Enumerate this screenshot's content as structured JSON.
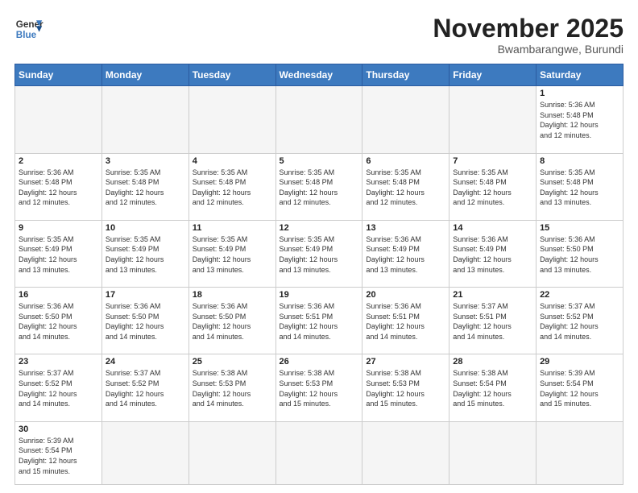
{
  "header": {
    "logo_general": "General",
    "logo_blue": "Blue",
    "month_title": "November 2025",
    "subtitle": "Bwambarangwe, Burundi"
  },
  "days_of_week": [
    "Sunday",
    "Monday",
    "Tuesday",
    "Wednesday",
    "Thursday",
    "Friday",
    "Saturday"
  ],
  "weeks": [
    [
      {
        "day": "",
        "info": ""
      },
      {
        "day": "",
        "info": ""
      },
      {
        "day": "",
        "info": ""
      },
      {
        "day": "",
        "info": ""
      },
      {
        "day": "",
        "info": ""
      },
      {
        "day": "",
        "info": ""
      },
      {
        "day": "1",
        "info": "Sunrise: 5:36 AM\nSunset: 5:48 PM\nDaylight: 12 hours\nand 12 minutes."
      }
    ],
    [
      {
        "day": "2",
        "info": "Sunrise: 5:36 AM\nSunset: 5:48 PM\nDaylight: 12 hours\nand 12 minutes."
      },
      {
        "day": "3",
        "info": "Sunrise: 5:35 AM\nSunset: 5:48 PM\nDaylight: 12 hours\nand 12 minutes."
      },
      {
        "day": "4",
        "info": "Sunrise: 5:35 AM\nSunset: 5:48 PM\nDaylight: 12 hours\nand 12 minutes."
      },
      {
        "day": "5",
        "info": "Sunrise: 5:35 AM\nSunset: 5:48 PM\nDaylight: 12 hours\nand 12 minutes."
      },
      {
        "day": "6",
        "info": "Sunrise: 5:35 AM\nSunset: 5:48 PM\nDaylight: 12 hours\nand 12 minutes."
      },
      {
        "day": "7",
        "info": "Sunrise: 5:35 AM\nSunset: 5:48 PM\nDaylight: 12 hours\nand 12 minutes."
      },
      {
        "day": "8",
        "info": "Sunrise: 5:35 AM\nSunset: 5:48 PM\nDaylight: 12 hours\nand 13 minutes."
      }
    ],
    [
      {
        "day": "9",
        "info": "Sunrise: 5:35 AM\nSunset: 5:49 PM\nDaylight: 12 hours\nand 13 minutes."
      },
      {
        "day": "10",
        "info": "Sunrise: 5:35 AM\nSunset: 5:49 PM\nDaylight: 12 hours\nand 13 minutes."
      },
      {
        "day": "11",
        "info": "Sunrise: 5:35 AM\nSunset: 5:49 PM\nDaylight: 12 hours\nand 13 minutes."
      },
      {
        "day": "12",
        "info": "Sunrise: 5:35 AM\nSunset: 5:49 PM\nDaylight: 12 hours\nand 13 minutes."
      },
      {
        "day": "13",
        "info": "Sunrise: 5:36 AM\nSunset: 5:49 PM\nDaylight: 12 hours\nand 13 minutes."
      },
      {
        "day": "14",
        "info": "Sunrise: 5:36 AM\nSunset: 5:49 PM\nDaylight: 12 hours\nand 13 minutes."
      },
      {
        "day": "15",
        "info": "Sunrise: 5:36 AM\nSunset: 5:50 PM\nDaylight: 12 hours\nand 13 minutes."
      }
    ],
    [
      {
        "day": "16",
        "info": "Sunrise: 5:36 AM\nSunset: 5:50 PM\nDaylight: 12 hours\nand 14 minutes."
      },
      {
        "day": "17",
        "info": "Sunrise: 5:36 AM\nSunset: 5:50 PM\nDaylight: 12 hours\nand 14 minutes."
      },
      {
        "day": "18",
        "info": "Sunrise: 5:36 AM\nSunset: 5:50 PM\nDaylight: 12 hours\nand 14 minutes."
      },
      {
        "day": "19",
        "info": "Sunrise: 5:36 AM\nSunset: 5:51 PM\nDaylight: 12 hours\nand 14 minutes."
      },
      {
        "day": "20",
        "info": "Sunrise: 5:36 AM\nSunset: 5:51 PM\nDaylight: 12 hours\nand 14 minutes."
      },
      {
        "day": "21",
        "info": "Sunrise: 5:37 AM\nSunset: 5:51 PM\nDaylight: 12 hours\nand 14 minutes."
      },
      {
        "day": "22",
        "info": "Sunrise: 5:37 AM\nSunset: 5:52 PM\nDaylight: 12 hours\nand 14 minutes."
      }
    ],
    [
      {
        "day": "23",
        "info": "Sunrise: 5:37 AM\nSunset: 5:52 PM\nDaylight: 12 hours\nand 14 minutes."
      },
      {
        "day": "24",
        "info": "Sunrise: 5:37 AM\nSunset: 5:52 PM\nDaylight: 12 hours\nand 14 minutes."
      },
      {
        "day": "25",
        "info": "Sunrise: 5:38 AM\nSunset: 5:53 PM\nDaylight: 12 hours\nand 14 minutes."
      },
      {
        "day": "26",
        "info": "Sunrise: 5:38 AM\nSunset: 5:53 PM\nDaylight: 12 hours\nand 15 minutes."
      },
      {
        "day": "27",
        "info": "Sunrise: 5:38 AM\nSunset: 5:53 PM\nDaylight: 12 hours\nand 15 minutes."
      },
      {
        "day": "28",
        "info": "Sunrise: 5:38 AM\nSunset: 5:54 PM\nDaylight: 12 hours\nand 15 minutes."
      },
      {
        "day": "29",
        "info": "Sunrise: 5:39 AM\nSunset: 5:54 PM\nDaylight: 12 hours\nand 15 minutes."
      }
    ],
    [
      {
        "day": "30",
        "info": "Sunrise: 5:39 AM\nSunset: 5:54 PM\nDaylight: 12 hours\nand 15 minutes."
      },
      {
        "day": "",
        "info": ""
      },
      {
        "day": "",
        "info": ""
      },
      {
        "day": "",
        "info": ""
      },
      {
        "day": "",
        "info": ""
      },
      {
        "day": "",
        "info": ""
      },
      {
        "day": "",
        "info": ""
      }
    ]
  ]
}
